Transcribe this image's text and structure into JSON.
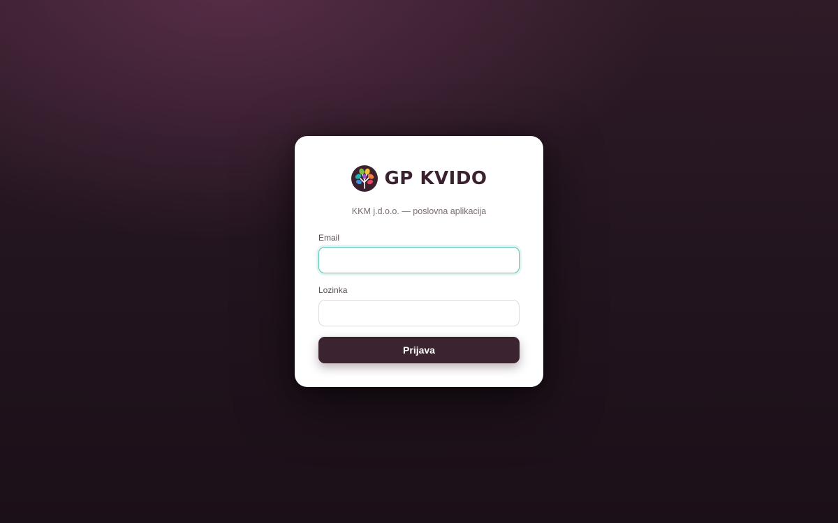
{
  "brand": {
    "name": "GP KVIDO",
    "logo_icon": "tree-icon",
    "text_color": "#3b2130"
  },
  "subtitle": "KKM j.d.o.o. — poslovna aplikacija",
  "form": {
    "email": {
      "label": "Email",
      "value": "",
      "placeholder": ""
    },
    "password": {
      "label": "Lozinka",
      "value": "",
      "placeholder": ""
    },
    "submit_label": "Prijava"
  },
  "colors": {
    "focus_ring": "#5cc2b4",
    "button_bg": "#3c2330",
    "page_bg": "#231520"
  }
}
